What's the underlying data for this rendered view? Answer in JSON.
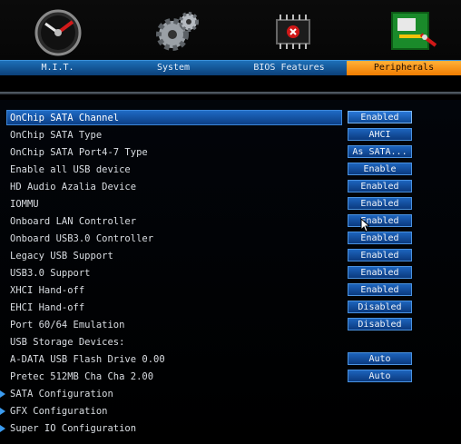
{
  "tabs": [
    {
      "label": "M.I.T.",
      "icon": "speedometer-icon"
    },
    {
      "label": "System",
      "icon": "gear-icon"
    },
    {
      "label": "BIOS Features",
      "icon": "chip-icon"
    },
    {
      "label": "Peripherals",
      "icon": "peripheral-card-icon",
      "active": true
    }
  ],
  "settings": [
    {
      "label": "OnChip SATA Channel",
      "value": "Enabled",
      "selected": true
    },
    {
      "label": "OnChip SATA Type",
      "value": "AHCI"
    },
    {
      "label": "OnChip SATA Port4-7 Type",
      "value": "As SATA..."
    },
    {
      "label": "Enable all USB device",
      "value": "Enable"
    },
    {
      "label": "HD Audio Azalia Device",
      "value": "Enabled"
    },
    {
      "label": "IOMMU",
      "value": "Enabled"
    },
    {
      "label": "Onboard LAN Controller",
      "value": "Enabled"
    },
    {
      "label": "Onboard USB3.0 Controller",
      "value": "Enabled"
    },
    {
      "label": "Legacy USB Support",
      "value": "Enabled"
    },
    {
      "label": "USB3.0 Support",
      "value": "Enabled"
    },
    {
      "label": "XHCI Hand-off",
      "value": "Enabled"
    },
    {
      "label": "EHCI Hand-off",
      "value": "Disabled"
    },
    {
      "label": "Port 60/64 Emulation",
      "value": "Disabled"
    },
    {
      "label": "USB Storage Devices:",
      "value": null
    },
    {
      "label": "A-DATA USB Flash Drive 0.00",
      "value": "Auto"
    },
    {
      "label": "Pretec 512MB Cha Cha 2.00",
      "value": "Auto"
    }
  ],
  "submenus": [
    {
      "label": "SATA Configuration"
    },
    {
      "label": "GFX Configuration"
    },
    {
      "label": "Super IO Configuration"
    }
  ],
  "colors": {
    "accent": "#f07c00",
    "tabbar": "#1d6fb8",
    "value_box": "#1d64bd"
  }
}
